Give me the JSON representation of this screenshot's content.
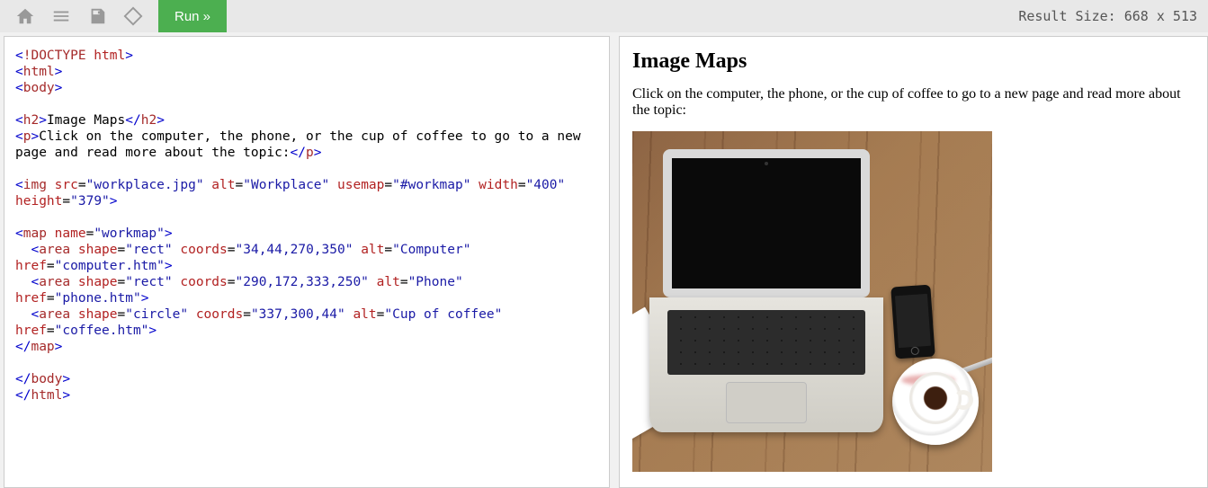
{
  "toolbar": {
    "run_label": "Run »",
    "result_size_label": "Result Size:",
    "result_width": "668",
    "result_x": "x",
    "result_height": "513"
  },
  "code": {
    "l1_open": "<",
    "l1_doctype": "!DOCTYPE",
    "l1_arg": " html",
    "l1_close": ">",
    "l2_open": "<",
    "l2_tag": "html",
    "l2_close": ">",
    "l3_open": "<",
    "l3_tag": "body",
    "l3_close": ">",
    "l5_open": "<",
    "l5_tag": "h2",
    "l5_close": ">",
    "l5_text": "Image Maps",
    "l5_open2": "</",
    "l5_tag2": "h2",
    "l5_close2": ">",
    "l6_open": "<",
    "l6_tag": "p",
    "l6_close": ">",
    "l6_text": "Click on the computer, the phone, or the cup of coffee to go to a new page and read more about the topic:",
    "l6_open2": "</",
    "l6_tag2": "p",
    "l6_close2": ">",
    "l8_open": "<",
    "l8_tag": "img",
    "l8_s": " ",
    "l8_a1": "src",
    "l8_eq": "=",
    "l8_v1": "\"workplace.jpg\"",
    "l8_a2": "alt",
    "l8_v2": "\"Workplace\"",
    "l8_a3": "usemap",
    "l8_v3": "\"#workmap\"",
    "l8_a4": "width",
    "l8_v4": "\"400\"",
    "l8_a5": "height",
    "l8_v5": "\"379\"",
    "l8_close": ">",
    "l10_open": "<",
    "l10_tag": "map",
    "l10_a1": "name",
    "l10_v1": "\"workmap\"",
    "l10_close": ">",
    "l11_indent": "  ",
    "l11_open": "<",
    "l11_tag": "area",
    "l11_a1": "shape",
    "l11_v1": "\"rect\"",
    "l11_a2": "coords",
    "l11_v2": "\"34,44,270,350\"",
    "l11_a3": "alt",
    "l11_v3": "\"Computer\"",
    "l11_a4": "href",
    "l11_v4": "\"computer.htm\"",
    "l11_close": ">",
    "l12_open": "<",
    "l12_tag": "area",
    "l12_a1": "shape",
    "l12_v1": "\"rect\"",
    "l12_a2": "coords",
    "l12_v2": "\"290,172,333,250\"",
    "l12_a3": "alt",
    "l12_v3": "\"Phone\"",
    "l12_a4": "href",
    "l12_v4": "\"phone.htm\"",
    "l12_close": ">",
    "l13_open": "<",
    "l13_tag": "area",
    "l13_a1": "shape",
    "l13_v1": "\"circle\"",
    "l13_a2": "coords",
    "l13_v2": "\"337,300,44\"",
    "l13_a3": "alt",
    "l13_v3": "\"Cup of coffee\"",
    "l13_a4": "href",
    "l13_v4": "\"coffee.htm\"",
    "l13_close": ">",
    "l14_open": "</",
    "l14_tag": "map",
    "l14_close": ">",
    "l16_open": "</",
    "l16_tag": "body",
    "l16_close": ">",
    "l17_open": "</",
    "l17_tag": "html",
    "l17_close": ">"
  },
  "result": {
    "heading": "Image Maps",
    "paragraph": "Click on the computer, the phone, or the cup of coffee to go to a new page and read more about the topic:",
    "img_alt": "Workplace",
    "map_name": "workmap",
    "area_computer_alt": "Computer",
    "area_computer_href": "computer.htm",
    "area_phone_alt": "Phone",
    "area_phone_href": "phone.htm",
    "area_coffee_alt": "Cup of coffee",
    "area_coffee_href": "coffee.htm"
  }
}
